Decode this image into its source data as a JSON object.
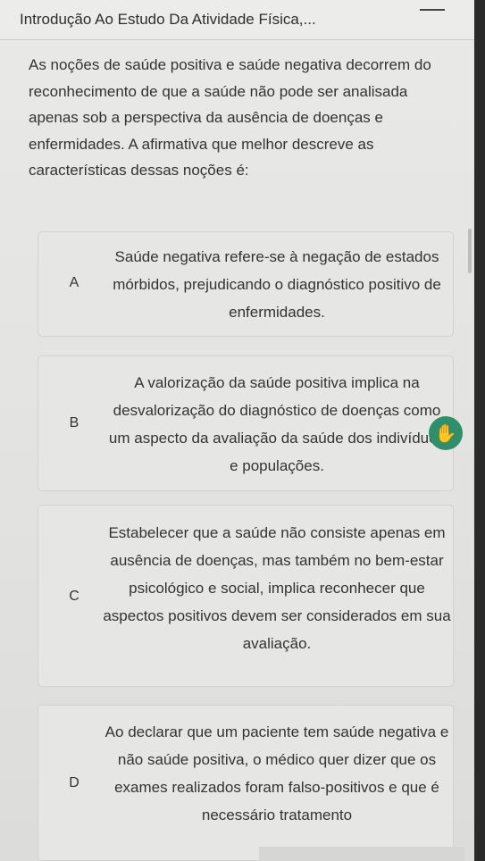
{
  "header": {
    "title": "Introdução Ao Estudo Da Atividade Física,..."
  },
  "question": {
    "text": "As noções de saúde positiva e saúde negativa decorrem do reconhecimento de que a saúde não pode ser analisada apenas sob a perspectiva da ausência de doenças e enfermidades. A afirmativa que melhor descreve as características dessas noções é:"
  },
  "options": [
    {
      "letter": "A",
      "text": "Saúde negativa refere-se à negação de estados mórbidos, prejudicando o diagnóstico positivo de enfermidades."
    },
    {
      "letter": "B",
      "text": "A valorização da saúde positiva implica na desvalorização do diagnóstico de doenças como um aspecto da avaliação da saúde dos indivíduos e populações."
    },
    {
      "letter": "C",
      "text": "Estabelecer que a saúde não consiste apenas em ausência de doenças, mas também no bem-estar psicológico e social, implica reconhecer que aspectos positivos devem ser considerados em sua avaliação."
    },
    {
      "letter": "D",
      "text": "Ao declarar que um paciente tem saúde negativa e não saúde positiva, o médico quer dizer que os exames realizados foram falso-positivos e que é necessário tratamento"
    }
  ],
  "accessibility": {
    "icon": "sign-language-hand-icon",
    "color": "#2f8f6a"
  }
}
